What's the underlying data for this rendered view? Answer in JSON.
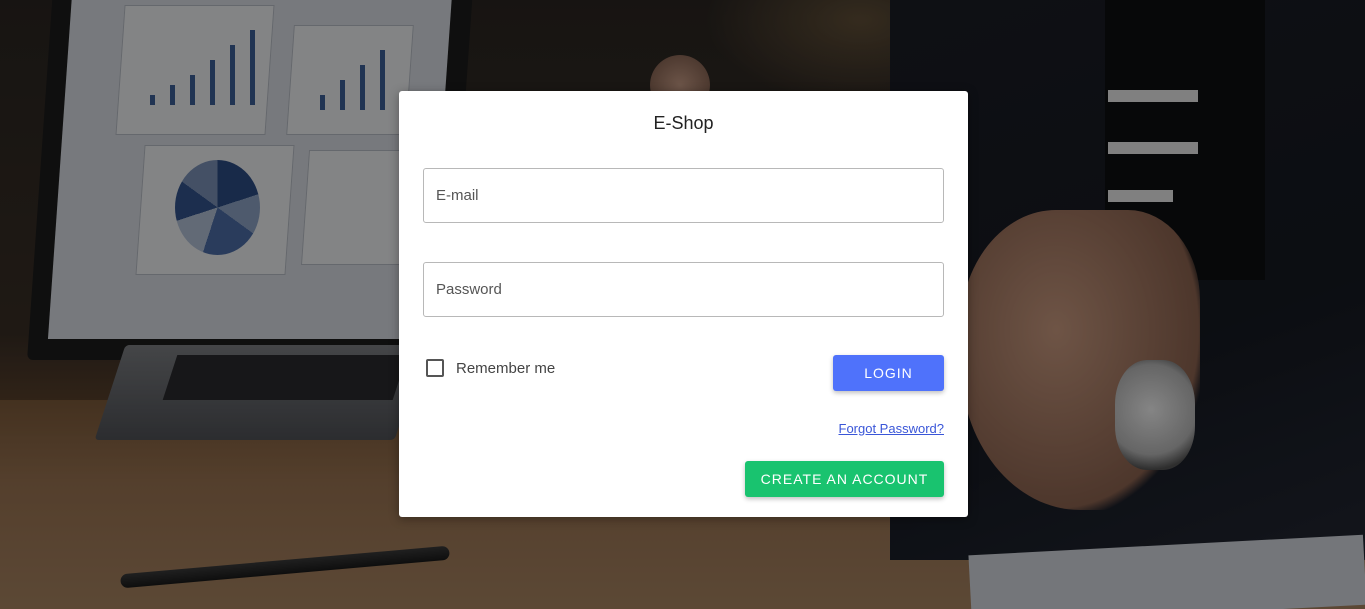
{
  "app": {
    "title": "E-Shop"
  },
  "form": {
    "email": {
      "value": "",
      "placeholder": "E-mail"
    },
    "password": {
      "value": "",
      "placeholder": "Password"
    },
    "remember": {
      "label": "Remember me",
      "checked": false
    },
    "login_label": "LOGIN",
    "forgot_label": "Forgot Password?",
    "create_label": "CREATE AN ACCOUNT"
  },
  "colors": {
    "login_button": "#4f72fb",
    "create_button": "#19c36f",
    "link": "#3a56d8"
  }
}
